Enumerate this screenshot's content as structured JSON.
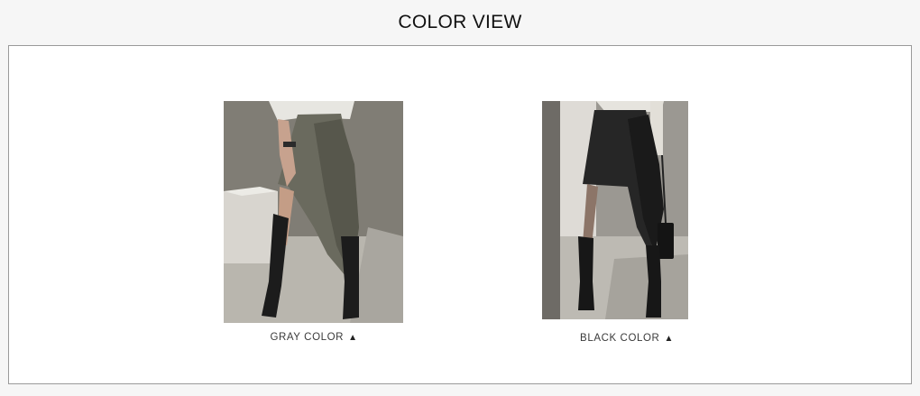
{
  "header": {
    "title": "COLOR VIEW"
  },
  "items": [
    {
      "caption": "GRAY COLOR",
      "arrow": "▲",
      "image": "model-gray-wrap-skirt-photo"
    },
    {
      "caption": "BLACK COLOR",
      "arrow": "▲",
      "image": "model-black-wrap-skirt-photo"
    }
  ],
  "colors": {
    "page_bg": "#f6f6f6",
    "panel_border": "#9a9a9a",
    "gray_skirt": "#6b6b5f",
    "black_skirt": "#232323"
  }
}
